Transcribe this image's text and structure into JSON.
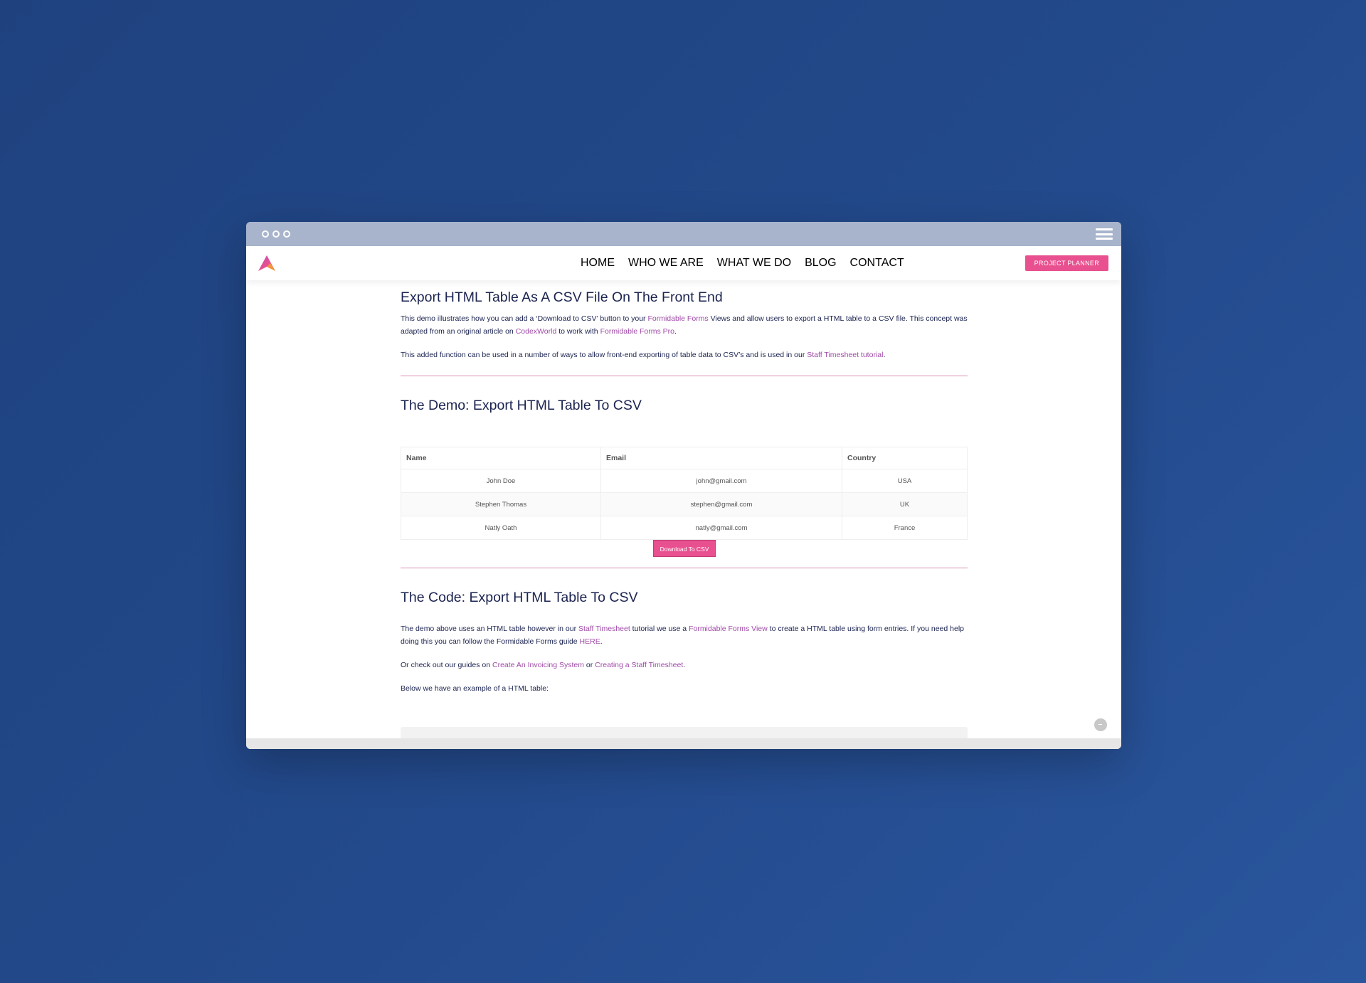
{
  "nav": {
    "items": [
      "HOME",
      "WHO WE ARE",
      "WHAT WE DO",
      "BLOG",
      "CONTACT"
    ],
    "cta": "PROJECT PLANNER"
  },
  "intro": {
    "title": "Export HTML Table As A CSV File On The Front End",
    "p1_a": "This demo illustrates how you can add a ‘Download to CSV’ button to your ",
    "p1_link1": "Formidable Forms",
    "p1_b": " Views and allow users to export a HTML table to a CSV file. This concept was adapted from an original article on ",
    "p1_link2": "CodexWorld",
    "p1_c": " to work with ",
    "p1_link3": "Formidable Forms Pro",
    "p1_d": ".",
    "p2_a": "This added function can be used in a number of ways to allow front-end exporting of table data to CSV’s and is used in our ",
    "p2_link": "Staff Timesheet tutorial",
    "p2_b": "."
  },
  "demo": {
    "title": "The Demo: Export HTML Table To CSV",
    "headers": [
      "Name",
      "Email",
      "Country"
    ],
    "rows": [
      [
        "John Doe",
        "john@gmail.com",
        "USA"
      ],
      [
        "Stephen Thomas",
        "stephen@gmail.com",
        "UK"
      ],
      [
        "Natly Oath",
        "natly@gmail.com",
        "France"
      ]
    ],
    "button": "Download To CSV"
  },
  "code": {
    "title": "The Code: Export HTML Table To CSV",
    "p1_a": "The demo above uses an HTML table however in our ",
    "p1_link1": "Staff Timesheet",
    "p1_b": " tutorial we use a ",
    "p1_link2": "Formidable Forms View",
    "p1_c": " to create a HTML table using form entries. If you need help doing this you can follow the Formidable Forms guide ",
    "p1_link3": "HERE",
    "p1_d": ".",
    "p2_a": "Or check out our guides on ",
    "p2_link1": "Create An Invoicing System",
    "p2_b": " or ",
    "p2_link2": "Creating a Staff Timesheet",
    "p2_c": ".",
    "p3": "Below we have an example of a HTML table:"
  },
  "colors": {
    "accent": "#e8508f",
    "link": "#a04aa8",
    "text": "#1b2350",
    "background": "#234a8c"
  }
}
